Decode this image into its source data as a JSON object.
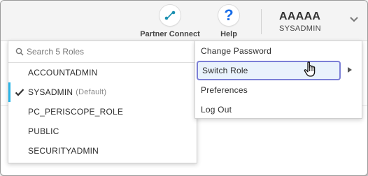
{
  "header": {
    "partner_connect_label": "Partner Connect",
    "help_label": "Help",
    "help_glyph": "?",
    "user_name": "AAAAA",
    "user_role": "SYSADMIN",
    "icons": [
      "partner-connect-icon",
      "help-icon",
      "chevron-down-icon"
    ],
    "accent_color": "#1a6ee8"
  },
  "roles_panel": {
    "search_placeholder": "Search 5 Roles",
    "items": [
      {
        "label": "ACCOUNTADMIN",
        "default_tag": "",
        "selected": false
      },
      {
        "label": "SYSADMIN",
        "default_tag": "(Default)",
        "selected": true
      },
      {
        "label": "PC_PERISCOPE_ROLE",
        "default_tag": "",
        "selected": false
      },
      {
        "label": "PUBLIC",
        "default_tag": "",
        "selected": false
      },
      {
        "label": "SECURITYADMIN",
        "default_tag": "",
        "selected": false
      }
    ],
    "selected_color": "#29b5e8"
  },
  "user_menu": {
    "items": [
      {
        "label": "Change Password"
      },
      {
        "label": "Switch Role",
        "highlighted": true,
        "has_submenu": true
      },
      {
        "label": "Preferences"
      },
      {
        "label": "Log Out"
      }
    ],
    "highlight_border_color": "#7b7fd6"
  }
}
